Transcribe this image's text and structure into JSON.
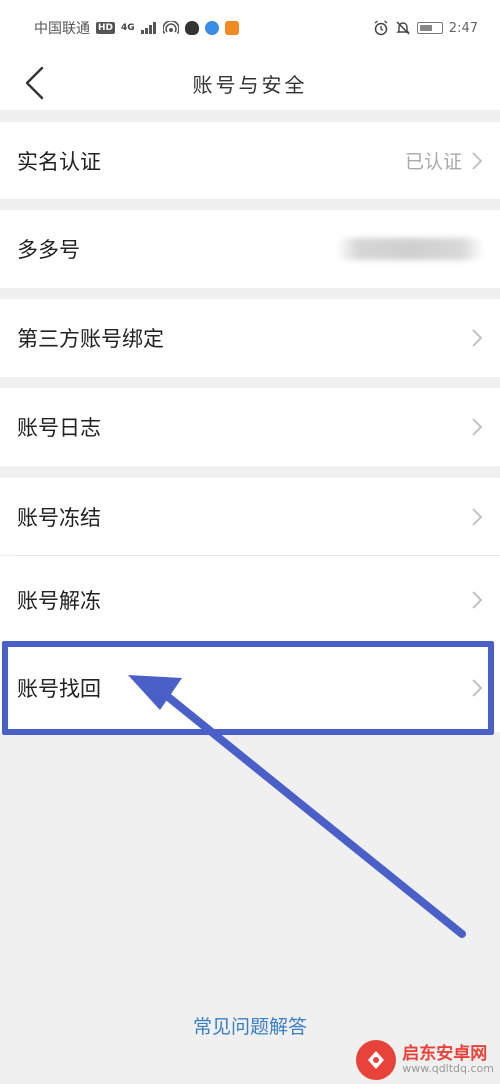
{
  "status_bar": {
    "carrier": "中国联通",
    "hd": "HD",
    "network": "4G",
    "time": "2:47"
  },
  "nav": {
    "title": "账号与安全"
  },
  "rows": {
    "real_name": {
      "label": "实名认证",
      "value": "已认证"
    },
    "duoduo_id": {
      "label": "多多号"
    },
    "third_party": {
      "label": "第三方账号绑定"
    },
    "account_log": {
      "label": "账号日志"
    },
    "freeze": {
      "label": "账号冻结"
    },
    "unfreeze": {
      "label": "账号解冻"
    },
    "recover": {
      "label": "账号找回"
    }
  },
  "faq": {
    "label": "常见问题解答"
  },
  "watermark": {
    "name": "启东安卓网",
    "url": "www.qdltdq.com"
  },
  "colors": {
    "annotation": "#4a5fc8",
    "link": "#3a7fc4",
    "background": "#f0f0f0"
  }
}
